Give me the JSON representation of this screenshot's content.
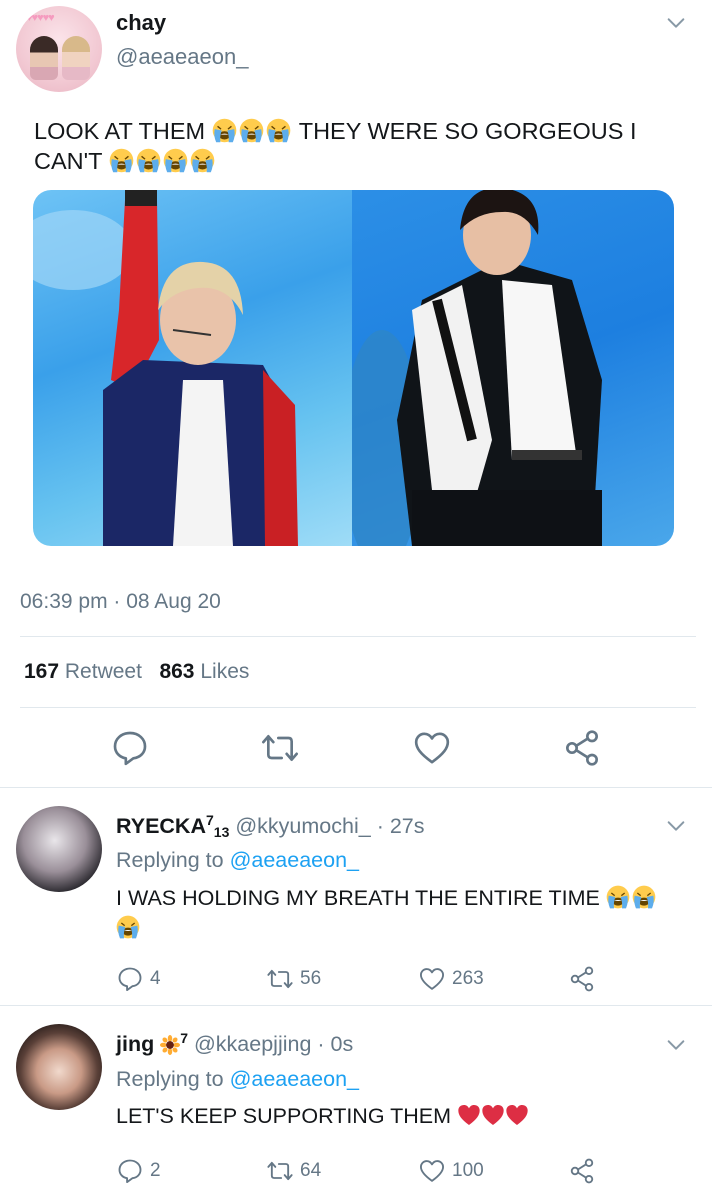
{
  "tweet": {
    "display_name": "chay",
    "handle": "@aeaeaeon_",
    "text_part1": "LOOK AT THEM",
    "text_part2": "THEY WERE SO GORGEOUS I",
    "text_part3": "CAN'T",
    "timestamp": "06:39 pm · 08 Aug 20",
    "retweets_count": "167",
    "retweets_label": "Retweet",
    "likes_count": "863",
    "likes_label": "Likes"
  },
  "replies": [
    {
      "display_name": "RYECKA",
      "name_sup": "7",
      "name_sub": "13",
      "handle": "@kkyumochi_",
      "time": "· 27s",
      "replying_prefix": "Replying to",
      "replying_handle": "@aeaeaeon_",
      "text": "I WAS HOLDING MY BREATH THE ENTIRE TIME",
      "reply_count": "4",
      "retweet_count": "56",
      "like_count": "263"
    },
    {
      "display_name": "jing",
      "name_sup": "7",
      "handle": "@kkaepjjing",
      "time": "· 0s",
      "replying_prefix": "Replying to",
      "replying_handle": "@aeaeaeon_",
      "text": "LET'S KEEP SUPPORTING THEM",
      "reply_count": "2",
      "retweet_count": "64",
      "like_count": "100"
    }
  ],
  "icons": {
    "crying": "loudly-crying-face-emoji",
    "heart_red": "red-heart-emoji",
    "sunflower": "sunflower-emoji",
    "reply": "reply-icon",
    "retweet": "retweet-icon",
    "like": "heart-icon",
    "share": "share-icon",
    "menu": "chevron-down-icon"
  },
  "colors": {
    "text": "#14171a",
    "secondary": "#657786",
    "link": "#1da1f2",
    "divider": "#e1e8ed",
    "heart_red": "#e0245e"
  }
}
